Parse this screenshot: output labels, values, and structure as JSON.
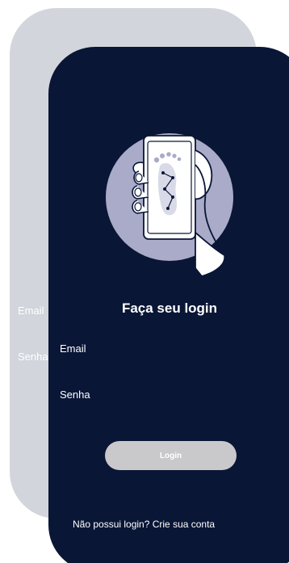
{
  "back_card": {
    "email_label": "Email",
    "senha_label": "Senha"
  },
  "login": {
    "title": "Faça seu login",
    "email_label": "Email",
    "email_value": "",
    "senha_label": "Senha",
    "senha_value": "",
    "button_label": "Login",
    "signup_link": "Não possui login? Crie sua conta"
  },
  "colors": {
    "background": "#ffffff",
    "back_card": "#d3d5dc",
    "front_card": "#0a1636",
    "circle": "#a9abc9",
    "button": "#c9c9cc"
  },
  "illustration": {
    "icon": "hand-holding-phone-footprint-icon"
  }
}
